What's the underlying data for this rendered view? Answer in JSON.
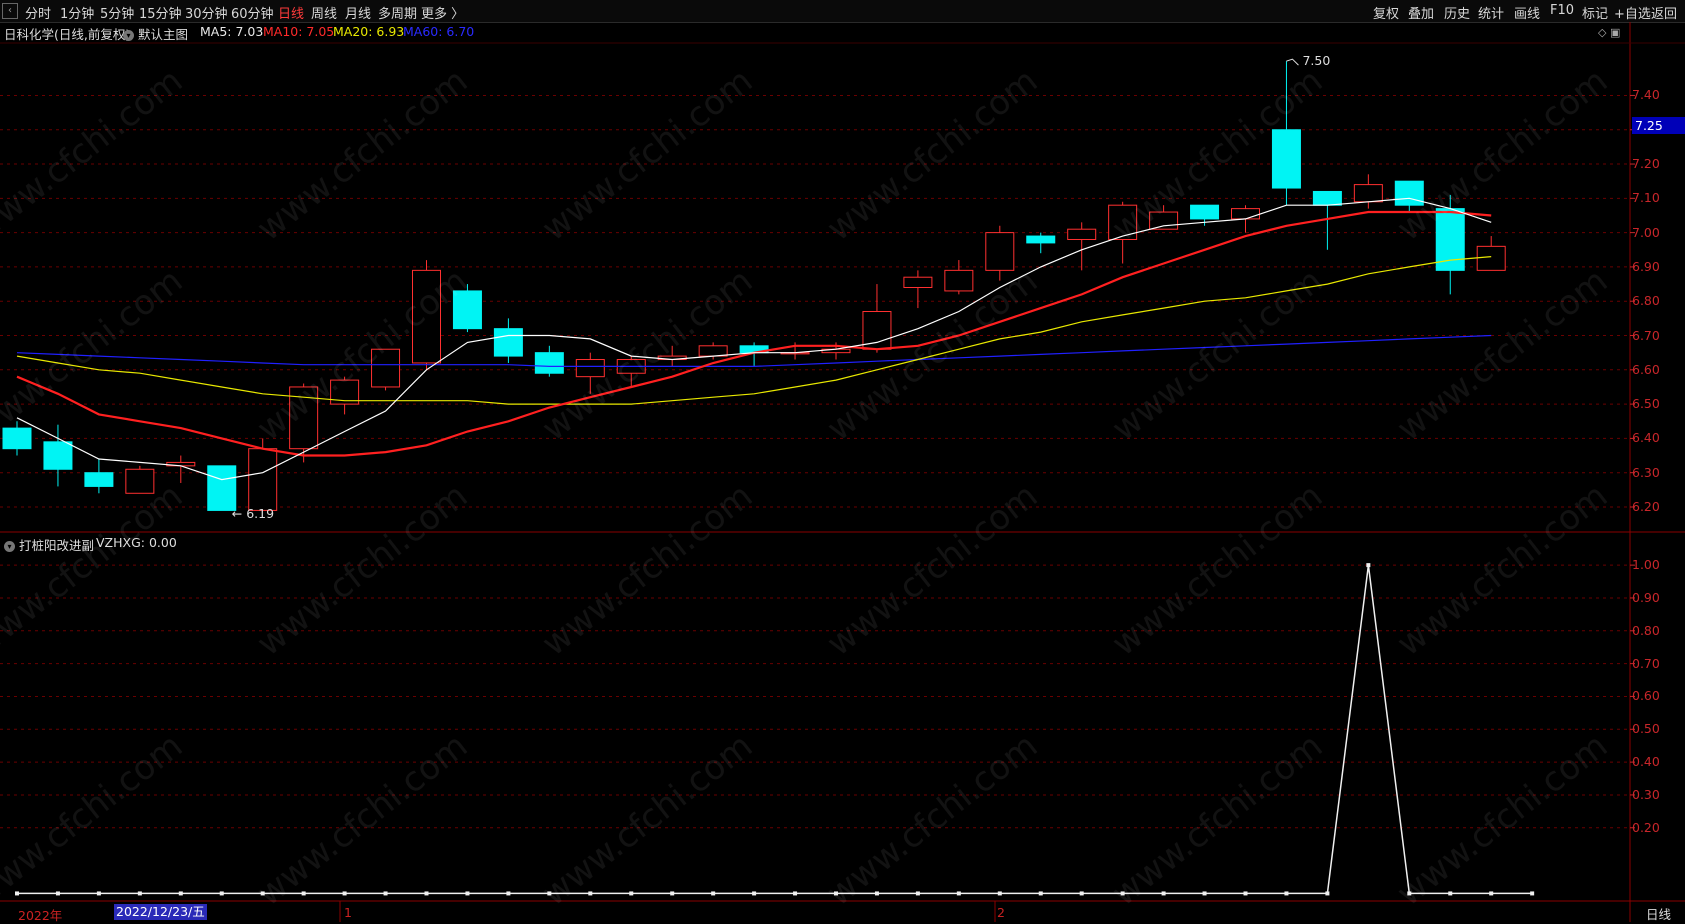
{
  "toolbar": {
    "periods": [
      "分时",
      "1分钟",
      "5分钟",
      "15分钟",
      "30分钟",
      "60分钟",
      "日线",
      "周线",
      "月线",
      "多周期",
      "更多 〉"
    ],
    "active_period": "日线",
    "right_buttons": [
      "复权",
      "叠加",
      "历史",
      "统计",
      "画线",
      "F10",
      "标记",
      "+自选",
      "返回"
    ]
  },
  "main_header": {
    "stock": "日科化学(日线,前复权)",
    "chart_name": "默认主图",
    "ma5": "MA5: 7.03",
    "ma10": "MA10: 7.05",
    "ma20": "MA20: 6.93",
    "ma60": "MA60: 6.70"
  },
  "indicator_header": {
    "name": "打桩阳改进副",
    "value": "VZHXG: 0.00"
  },
  "annotations": {
    "high": "7.50",
    "low": "6.19",
    "last_price": "7.25"
  },
  "x_axis": {
    "year": "2022年",
    "cursor_date": "2022/12/23/五",
    "m1": "1",
    "m2": "2"
  },
  "period_label": "日线",
  "watermark": "www.cfchi.com",
  "colors": {
    "up": "#ff3030",
    "down": "#00f4f4",
    "ma5": "#ffffff",
    "ma10": "#ff2020",
    "ma20": "#e8e800",
    "ma60": "#2020ff",
    "grid": "#6a0000"
  },
  "chart_data": [
    {
      "type": "candlestick",
      "title": "日科化学(日线,前复权)",
      "y_ticks": [
        6.2,
        6.3,
        6.4,
        6.5,
        6.6,
        6.7,
        6.8,
        6.9,
        7.0,
        7.1,
        7.2,
        7.3,
        7.4
      ],
      "ylim": [
        6.13,
        7.55
      ],
      "candles": [
        {
          "o": 6.43,
          "h": 6.45,
          "l": 6.35,
          "c": 6.37
        },
        {
          "o": 6.39,
          "h": 6.44,
          "l": 6.26,
          "c": 6.31
        },
        {
          "o": 6.3,
          "h": 6.34,
          "l": 6.24,
          "c": 6.26
        },
        {
          "o": 6.24,
          "h": 6.32,
          "l": 6.24,
          "c": 6.31
        },
        {
          "o": 6.32,
          "h": 6.35,
          "l": 6.27,
          "c": 6.33
        },
        {
          "o": 6.32,
          "h": 6.32,
          "l": 6.19,
          "c": 6.19
        },
        {
          "o": 6.19,
          "h": 6.4,
          "l": 6.19,
          "c": 6.37
        },
        {
          "o": 6.37,
          "h": 6.56,
          "l": 6.33,
          "c": 6.55
        },
        {
          "o": 6.5,
          "h": 6.58,
          "l": 6.47,
          "c": 6.57
        },
        {
          "o": 6.55,
          "h": 6.66,
          "l": 6.54,
          "c": 6.66
        },
        {
          "o": 6.62,
          "h": 6.92,
          "l": 6.6,
          "c": 6.89
        },
        {
          "o": 6.83,
          "h": 6.85,
          "l": 6.71,
          "c": 6.72
        },
        {
          "o": 6.72,
          "h": 6.75,
          "l": 6.62,
          "c": 6.64
        },
        {
          "o": 6.65,
          "h": 6.67,
          "l": 6.58,
          "c": 6.59
        },
        {
          "o": 6.58,
          "h": 6.65,
          "l": 6.53,
          "c": 6.63
        },
        {
          "o": 6.59,
          "h": 6.64,
          "l": 6.55,
          "c": 6.63
        },
        {
          "o": 6.63,
          "h": 6.67,
          "l": 6.61,
          "c": 6.64
        },
        {
          "o": 6.64,
          "h": 6.68,
          "l": 6.63,
          "c": 6.67
        },
        {
          "o": 6.67,
          "h": 6.68,
          "l": 6.61,
          "c": 6.65
        },
        {
          "o": 6.65,
          "h": 6.68,
          "l": 6.63,
          "c": 6.65
        },
        {
          "o": 6.65,
          "h": 6.68,
          "l": 6.63,
          "c": 6.66
        },
        {
          "o": 6.66,
          "h": 6.85,
          "l": 6.65,
          "c": 6.77
        },
        {
          "o": 6.84,
          "h": 6.89,
          "l": 6.78,
          "c": 6.87
        },
        {
          "o": 6.83,
          "h": 6.92,
          "l": 6.82,
          "c": 6.89
        },
        {
          "o": 6.89,
          "h": 7.02,
          "l": 6.86,
          "c": 7.0
        },
        {
          "o": 6.99,
          "h": 7.0,
          "l": 6.94,
          "c": 6.97
        },
        {
          "o": 6.98,
          "h": 7.03,
          "l": 6.89,
          "c": 7.01
        },
        {
          "o": 6.98,
          "h": 7.09,
          "l": 6.91,
          "c": 7.08
        },
        {
          "o": 7.01,
          "h": 7.08,
          "l": 7.01,
          "c": 7.06
        },
        {
          "o": 7.08,
          "h": 7.08,
          "l": 7.02,
          "c": 7.04
        },
        {
          "o": 7.04,
          "h": 7.08,
          "l": 7.0,
          "c": 7.07
        },
        {
          "o": 7.3,
          "h": 7.5,
          "l": 7.08,
          "c": 7.13
        },
        {
          "o": 7.12,
          "h": 7.12,
          "l": 6.95,
          "c": 7.08
        },
        {
          "o": 7.09,
          "h": 7.17,
          "l": 7.07,
          "c": 7.14
        },
        {
          "o": 7.15,
          "h": 7.15,
          "l": 7.06,
          "c": 7.08
        },
        {
          "o": 7.07,
          "h": 7.11,
          "l": 6.82,
          "c": 6.89
        },
        {
          "o": 6.89,
          "h": 6.99,
          "l": 6.89,
          "c": 6.96
        }
      ],
      "ma5": [
        6.46,
        6.4,
        6.34,
        6.33,
        6.32,
        6.28,
        6.3,
        6.36,
        6.42,
        6.48,
        6.6,
        6.68,
        6.7,
        6.7,
        6.69,
        6.64,
        6.63,
        6.64,
        6.65,
        6.65,
        6.66,
        6.68,
        6.72,
        6.77,
        6.84,
        6.9,
        6.95,
        6.99,
        7.02,
        7.03,
        7.04,
        7.08,
        7.08,
        7.09,
        7.1,
        7.07,
        7.03
      ],
      "ma10": [
        6.58,
        6.53,
        6.47,
        6.45,
        6.43,
        6.4,
        6.37,
        6.35,
        6.35,
        6.36,
        6.38,
        6.42,
        6.45,
        6.49,
        6.52,
        6.55,
        6.58,
        6.62,
        6.65,
        6.67,
        6.67,
        6.66,
        6.67,
        6.7,
        6.74,
        6.78,
        6.82,
        6.87,
        6.91,
        6.95,
        6.99,
        7.02,
        7.04,
        7.06,
        7.06,
        7.06,
        7.05
      ],
      "ma20": [
        6.64,
        6.62,
        6.6,
        6.59,
        6.57,
        6.55,
        6.53,
        6.52,
        6.51,
        6.51,
        6.51,
        6.51,
        6.5,
        6.5,
        6.5,
        6.5,
        6.51,
        6.52,
        6.53,
        6.55,
        6.57,
        6.6,
        6.63,
        6.66,
        6.69,
        6.71,
        6.74,
        6.76,
        6.78,
        6.8,
        6.81,
        6.83,
        6.85,
        6.88,
        6.9,
        6.92,
        6.93
      ],
      "ma60": [
        6.65,
        6.645,
        6.64,
        6.635,
        6.63,
        6.625,
        6.62,
        6.615,
        6.615,
        6.615,
        6.615,
        6.615,
        6.615,
        6.61,
        6.61,
        6.61,
        6.61,
        6.61,
        6.61,
        6.615,
        6.62,
        6.625,
        6.63,
        6.635,
        6.64,
        6.645,
        6.65,
        6.655,
        6.66,
        6.665,
        6.67,
        6.675,
        6.68,
        6.685,
        6.69,
        6.695,
        6.7
      ]
    },
    {
      "type": "line",
      "title": "打桩阳改进副",
      "series": [
        {
          "name": "VZHXG",
          "values": [
            0,
            0,
            0,
            0,
            0,
            0,
            0,
            0,
            0,
            0,
            0,
            0,
            0,
            0,
            0,
            0,
            0,
            0,
            0,
            0,
            0,
            0,
            0,
            0,
            0,
            0,
            0,
            0,
            0,
            0,
            0,
            0,
            0,
            1,
            0,
            0,
            0,
            0
          ]
        }
      ],
      "y_ticks": [
        0.2,
        0.3,
        0.4,
        0.5,
        0.6,
        0.7,
        0.8,
        0.9,
        1.0
      ],
      "ylim": [
        -0.02,
        1.04
      ]
    }
  ]
}
